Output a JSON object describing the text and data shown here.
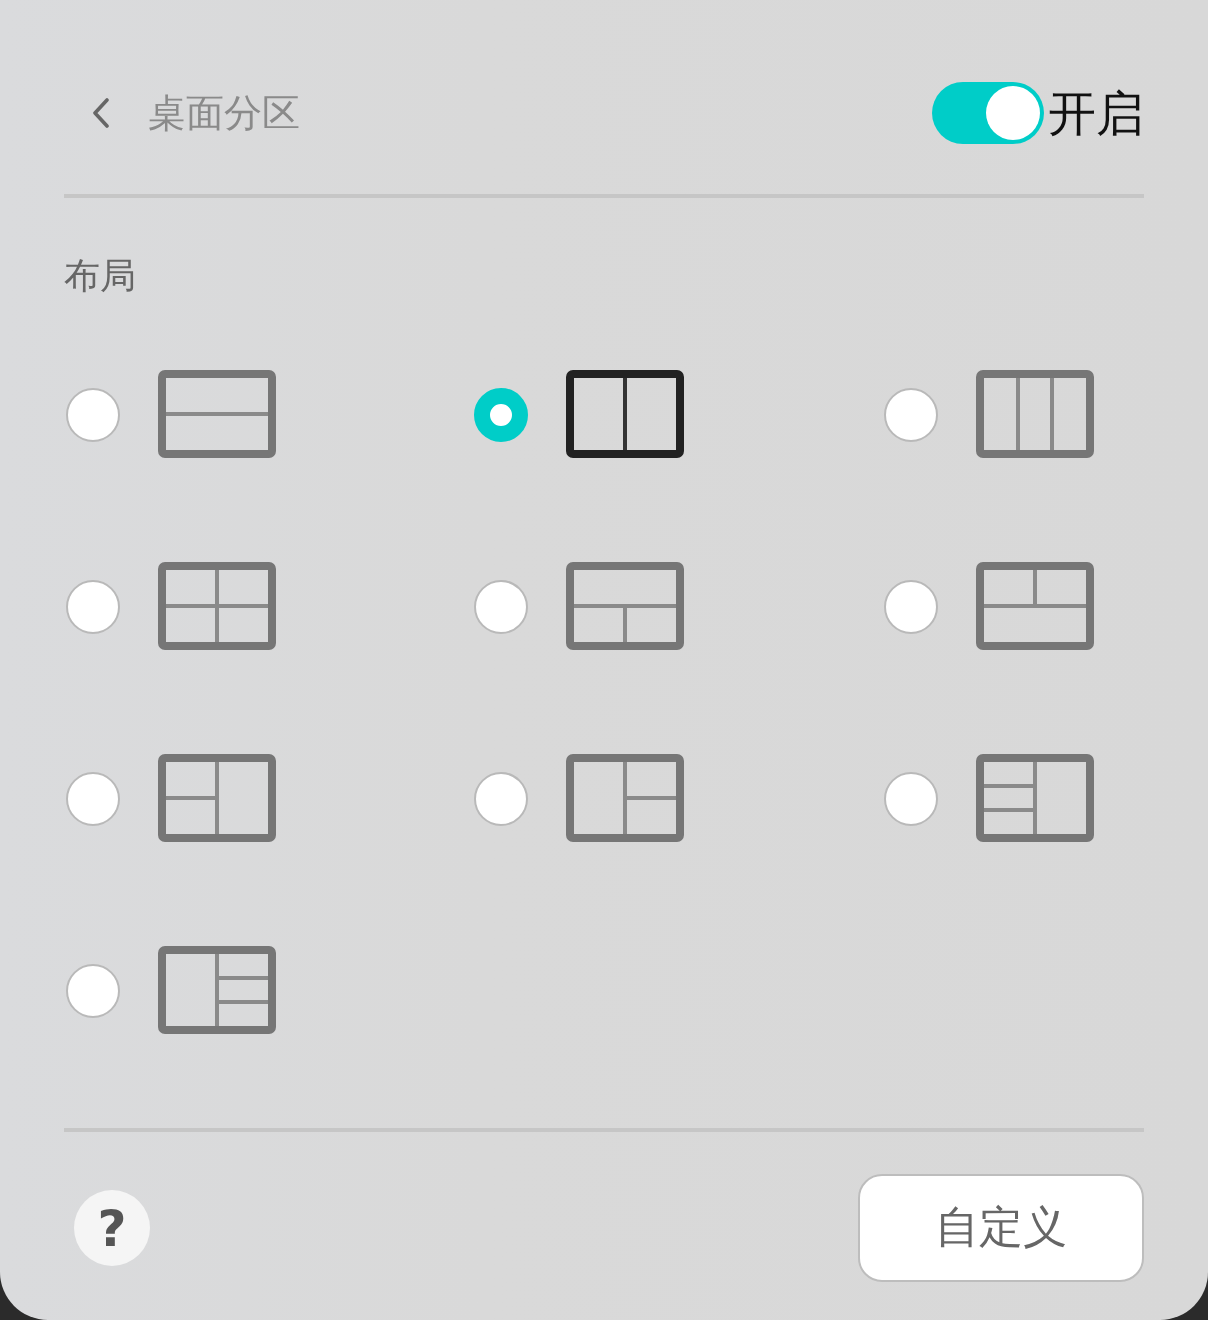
{
  "header": {
    "title": "桌面分区",
    "toggle": {
      "on": true,
      "label": "开启"
    }
  },
  "section": {
    "label": "布局"
  },
  "layouts": [
    {
      "kind": "rows",
      "selected": false
    },
    {
      "kind": "columns",
      "selected": true
    },
    {
      "kind": "thirds",
      "selected": false
    },
    {
      "kind": "quarters",
      "selected": false
    },
    {
      "kind": "bottomsplit",
      "selected": false
    },
    {
      "kind": "topsplit",
      "selected": false
    },
    {
      "kind": "leftsplit",
      "selected": false
    },
    {
      "kind": "rightsplit",
      "selected": false
    },
    {
      "kind": "leftstack",
      "selected": false
    },
    {
      "kind": "rightstack",
      "selected": false
    }
  ],
  "footer": {
    "help_button": {
      "label": "?"
    },
    "custom_button": {
      "label": "自定义"
    }
  }
}
